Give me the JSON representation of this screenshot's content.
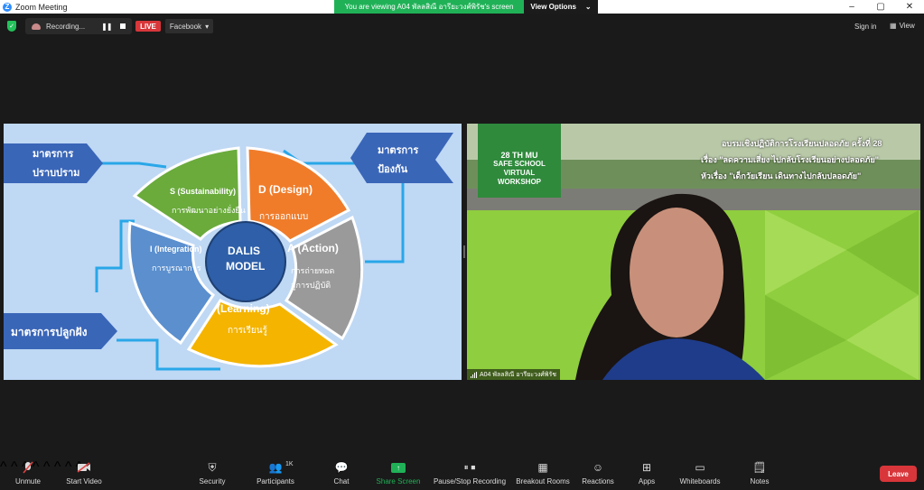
{
  "window": {
    "title": "Zoom Meeting",
    "controls": [
      "–",
      "▢",
      "✕"
    ]
  },
  "banner": {
    "viewing_text": "You are viewing A04 พัลลสิณี อารียะวงศ์พิรัช's screen",
    "view_options": "View Options"
  },
  "topbar": {
    "recording_label": "Recording...",
    "live_label": "LIVE",
    "stream_target": "Facebook",
    "sign_in": "Sign in",
    "view": "View"
  },
  "slide": {
    "left_top_arrow": [
      "มาตรการ",
      "ปราบปราม"
    ],
    "right_top_arrow": [
      "มาตรการ",
      "ป้องกัน"
    ],
    "bottom_left_arrow": "มาตรการปลูกฝัง",
    "center": [
      "DALIS",
      "MODEL"
    ],
    "segments": {
      "sustainability": {
        "title": "S (Sustainability)",
        "sub": "การพัฒนาอย่างยั่งยืน"
      },
      "design": {
        "title": "D (Design)",
        "sub": "การออกแบบ"
      },
      "action": {
        "title": "A (Action)",
        "sub1": "การถ่ายทอด",
        "sub2": "สู่การปฏิบัติ"
      },
      "learning": {
        "title": "(Learning)",
        "sub": "การเรียนรู้"
      },
      "integration": {
        "title": "I (Integration)",
        "sub": "การบูรณาการ"
      }
    },
    "colors": {
      "bg": "#bfd8f4",
      "green": "#6aab3c",
      "orange": "#f07c2a",
      "gray": "#9a9a9a",
      "yellow": "#f4b400",
      "blue": "#5b8fce",
      "center": "#2e5fa8",
      "arrow": "#3a66b8"
    }
  },
  "video": {
    "workshop": [
      "28 TH MU",
      "SAFE SCHOOL",
      "VIRTUAL",
      "WORKSHOP"
    ],
    "heading1": "อบรมเชิงปฏิบัติการโรงเรียนปลอดภัย ครั้งที่ 28",
    "heading2": "เรื่อง \"ลดความเสี่ยง ไปกลับโรงเรียนอย่างปลอดภัย\"",
    "heading3": "หัวเรื่อง \"เด็กวัยเรียน เดินทางไปกลับปลอดภัย\"",
    "participant_name": "A04 พัลลสิณี อารียะวงศ์พิรัช"
  },
  "toolbar": {
    "unmute": "Unmute",
    "start_video": "Start Video",
    "security": "Security",
    "participants": "Participants",
    "participants_count": "1K",
    "chat": "Chat",
    "share_screen": "Share Screen",
    "pause_stop_recording": "Pause/Stop Recording",
    "breakout_rooms": "Breakout Rooms",
    "reactions": "Reactions",
    "apps": "Apps",
    "whiteboards": "Whiteboards",
    "notes": "Notes",
    "leave": "Leave"
  }
}
